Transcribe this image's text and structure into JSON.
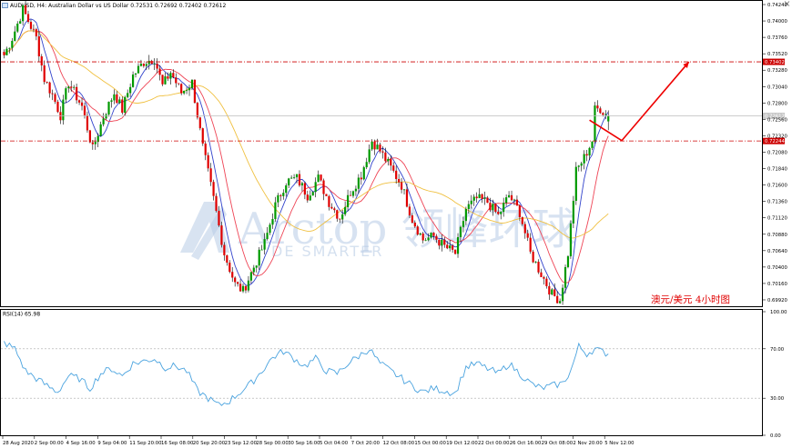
{
  "window": {
    "title": "AUDUSD, H4: Australian Dollar vs US Dollar  0.72531 0.72692 0.72402 0.72612",
    "close_icon": "close-icon",
    "symbol_icon": "chart-icon"
  },
  "annotation": {
    "text": "澳元/美元     4小时图",
    "watermark": "Arctop 领峰环球",
    "watermark_sub": "DE SMARTER"
  },
  "colors": {
    "bull": "#009900",
    "bear": "#e00000",
    "ma_fast": "#3344cc",
    "ma_mid": "#ee4455",
    "ma_slow": "#f0c040",
    "rsi": "#4aa3df",
    "level": "#cc0000",
    "current": "#bbbbbb",
    "arrow": "#ee0000"
  },
  "chart_data": [
    {
      "type": "candlestick",
      "title": "AUDUSD, H4: Australian Dollar vs US Dollar",
      "ohlc_last": {
        "open": 0.72531,
        "high": 0.72692,
        "low": 0.72402,
        "close": 0.72612
      },
      "ylim": [
        0.6984,
        0.7428
      ],
      "y_ticks": [
        "0.74240",
        "0.74000",
        "0.73760",
        "0.73520",
        "0.73280",
        "0.73040",
        "0.72800",
        "0.72560",
        "0.72320",
        "0.72080",
        "0.71840",
        "0.71600",
        "0.71360",
        "0.71120",
        "0.70880",
        "0.70640",
        "0.70400",
        "0.70160",
        "0.69920"
      ],
      "x_labels": [
        "28 Aug 2020",
        "2 Sep 00:00",
        "4 Sep 16:00",
        "9 Sep 04:00",
        "11 Sep 20:00",
        "16 Sep 08:00",
        "20 Sep 20:00",
        "23 Sep 12:00",
        "28 Sep 00:00",
        "30 Sep 16:00",
        "5 Oct 04:00",
        "7 Oct 20:00",
        "12 Oct 08:00",
        "15 Oct 00:00",
        "19 Oct 12:00",
        "22 Oct 00:00",
        "26 Oct 16:00",
        "29 Oct 08:00",
        "2 Nov 20:00",
        "5 Nov 12:00"
      ],
      "levels": [
        {
          "label": "0.73402",
          "value": 0.73402
        },
        {
          "label": "0.72244",
          "value": 0.72244
        }
      ],
      "current_label": "0.72612",
      "current_value": 0.72612,
      "projection": [
        {
          "bar": 218,
          "price": 0.7255
        },
        {
          "bar": 230,
          "price": 0.7225
        },
        {
          "bar": 255,
          "price": 0.734
        }
      ],
      "anchors": [
        [
          0,
          0.735
        ],
        [
          3,
          0.7375
        ],
        [
          7,
          0.7417
        ],
        [
          12,
          0.7375
        ],
        [
          15,
          0.7315
        ],
        [
          18,
          0.7292
        ],
        [
          21,
          0.7262
        ],
        [
          24,
          0.731
        ],
        [
          29,
          0.7275
        ],
        [
          33,
          0.7212
        ],
        [
          37,
          0.726
        ],
        [
          41,
          0.7295
        ],
        [
          44,
          0.727
        ],
        [
          48,
          0.732
        ],
        [
          52,
          0.734
        ],
        [
          56,
          0.7345
        ],
        [
          59,
          0.7305
        ],
        [
          62,
          0.7325
        ],
        [
          66,
          0.7295
        ],
        [
          70,
          0.731
        ],
        [
          74,
          0.7215
        ],
        [
          78,
          0.714
        ],
        [
          82,
          0.706
        ],
        [
          86,
          0.7015
        ],
        [
          89,
          0.7005
        ],
        [
          93,
          0.704
        ],
        [
          97,
          0.7075
        ],
        [
          101,
          0.713
        ],
        [
          105,
          0.7165
        ],
        [
          109,
          0.717
        ],
        [
          113,
          0.7145
        ],
        [
          117,
          0.717
        ],
        [
          121,
          0.7135
        ],
        [
          125,
          0.7112
        ],
        [
          129,
          0.715
        ],
        [
          133,
          0.7175
        ],
        [
          137,
          0.7225
        ],
        [
          140,
          0.721
        ],
        [
          144,
          0.7185
        ],
        [
          148,
          0.716
        ],
        [
          152,
          0.711
        ],
        [
          156,
          0.708
        ],
        [
          160,
          0.7085
        ],
        [
          164,
          0.707
        ],
        [
          168,
          0.706
        ],
        [
          172,
          0.7125
        ],
        [
          176,
          0.714
        ],
        [
          180,
          0.7135
        ],
        [
          184,
          0.7115
        ],
        [
          188,
          0.7145
        ],
        [
          192,
          0.712
        ],
        [
          196,
          0.706
        ],
        [
          200,
          0.703
        ],
        [
          204,
          0.7
        ],
        [
          207,
          0.6992
        ],
        [
          210,
          0.706
        ],
        [
          213,
          0.718
        ],
        [
          216,
          0.72
        ],
        [
          219,
          0.7225
        ],
        [
          220,
          0.727
        ],
        [
          222,
          0.7272
        ],
        [
          225,
          0.726
        ]
      ]
    },
    {
      "type": "line",
      "title": "RSI(14) 65.98",
      "ylim": [
        0,
        100
      ],
      "y_ticks": [
        "100.00",
        "70.00",
        "30.00",
        "0.00"
      ],
      "levels": [
        70,
        30
      ],
      "anchors": [
        [
          0,
          75
        ],
        [
          4,
          70
        ],
        [
          8,
          52
        ],
        [
          12,
          46
        ],
        [
          16,
          40
        ],
        [
          20,
          35
        ],
        [
          24,
          48
        ],
        [
          28,
          46
        ],
        [
          32,
          38
        ],
        [
          36,
          50
        ],
        [
          40,
          54
        ],
        [
          44,
          48
        ],
        [
          48,
          58
        ],
        [
          52,
          60
        ],
        [
          56,
          62
        ],
        [
          60,
          55
        ],
        [
          64,
          56
        ],
        [
          68,
          52
        ],
        [
          72,
          36
        ],
        [
          76,
          30
        ],
        [
          80,
          24
        ],
        [
          84,
          28
        ],
        [
          88,
          35
        ],
        [
          92,
          42
        ],
        [
          96,
          52
        ],
        [
          100,
          63
        ],
        [
          104,
          68
        ],
        [
          108,
          62
        ],
        [
          112,
          56
        ],
        [
          116,
          62
        ],
        [
          120,
          52
        ],
        [
          124,
          50
        ],
        [
          128,
          58
        ],
        [
          132,
          64
        ],
        [
          136,
          70
        ],
        [
          140,
          58
        ],
        [
          144,
          52
        ],
        [
          148,
          46
        ],
        [
          152,
          40
        ],
        [
          156,
          35
        ],
        [
          160,
          38
        ],
        [
          164,
          36
        ],
        [
          168,
          34
        ],
        [
          172,
          55
        ],
        [
          176,
          58
        ],
        [
          180,
          54
        ],
        [
          184,
          50
        ],
        [
          188,
          58
        ],
        [
          192,
          50
        ],
        [
          196,
          42
        ],
        [
          200,
          38
        ],
        [
          204,
          40
        ],
        [
          208,
          42
        ],
        [
          211,
          52
        ],
        [
          214,
          72
        ],
        [
          217,
          66
        ],
        [
          220,
          70
        ],
        [
          222,
          68
        ],
        [
          225,
          66
        ]
      ]
    }
  ]
}
